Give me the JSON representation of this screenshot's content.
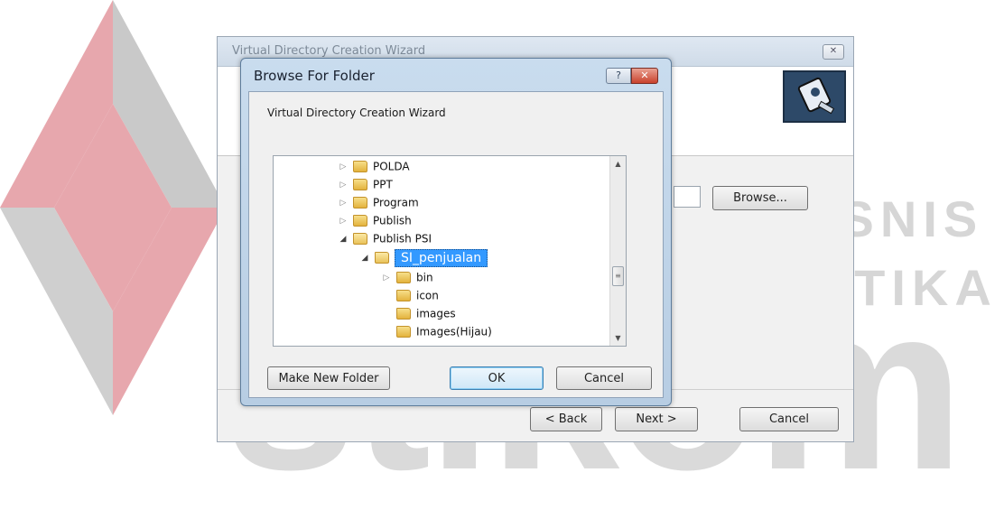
{
  "watermark": {
    "line1": "INSTITUT BISNIS",
    "line2": "& INFORMATIKA",
    "brand": "stikom",
    "colors": {
      "logo_red": "#e04a55",
      "logo_gray": "#b8b8b8",
      "text_gray": "#d6d6d6"
    }
  },
  "wizard": {
    "title": "Virtual Directory Creation Wizard",
    "close_icon": "close-icon",
    "browse_label": "Browse...",
    "back_label": "< Back",
    "next_label": "Next >",
    "cancel_label": "Cancel"
  },
  "dialog": {
    "title": "Browse For Folder",
    "help_icon": "help-icon",
    "close_icon": "close-icon",
    "description": "Virtual Directory Creation Wizard",
    "tree": [
      {
        "label": "POLDA",
        "expanded": false,
        "level": 0
      },
      {
        "label": "PPT",
        "expanded": false,
        "level": 0
      },
      {
        "label": "Program",
        "expanded": false,
        "level": 0
      },
      {
        "label": "Publish",
        "expanded": false,
        "level": 0
      },
      {
        "label": "Publish PSI",
        "expanded": true,
        "level": 0
      },
      {
        "label": "SI_penjualan",
        "expanded": true,
        "level": 1,
        "selected": true
      },
      {
        "label": "bin",
        "expanded": false,
        "level": 2
      },
      {
        "label": "icon",
        "level": 2
      },
      {
        "label": "images",
        "level": 2
      },
      {
        "label": "Images(Hijau)",
        "level": 2
      }
    ],
    "make_folder_label": "Make New Folder",
    "ok_label": "OK",
    "cancel_label": "Cancel",
    "colors": {
      "selection": "#3399ff",
      "title_bar": "#c9dcee"
    }
  }
}
